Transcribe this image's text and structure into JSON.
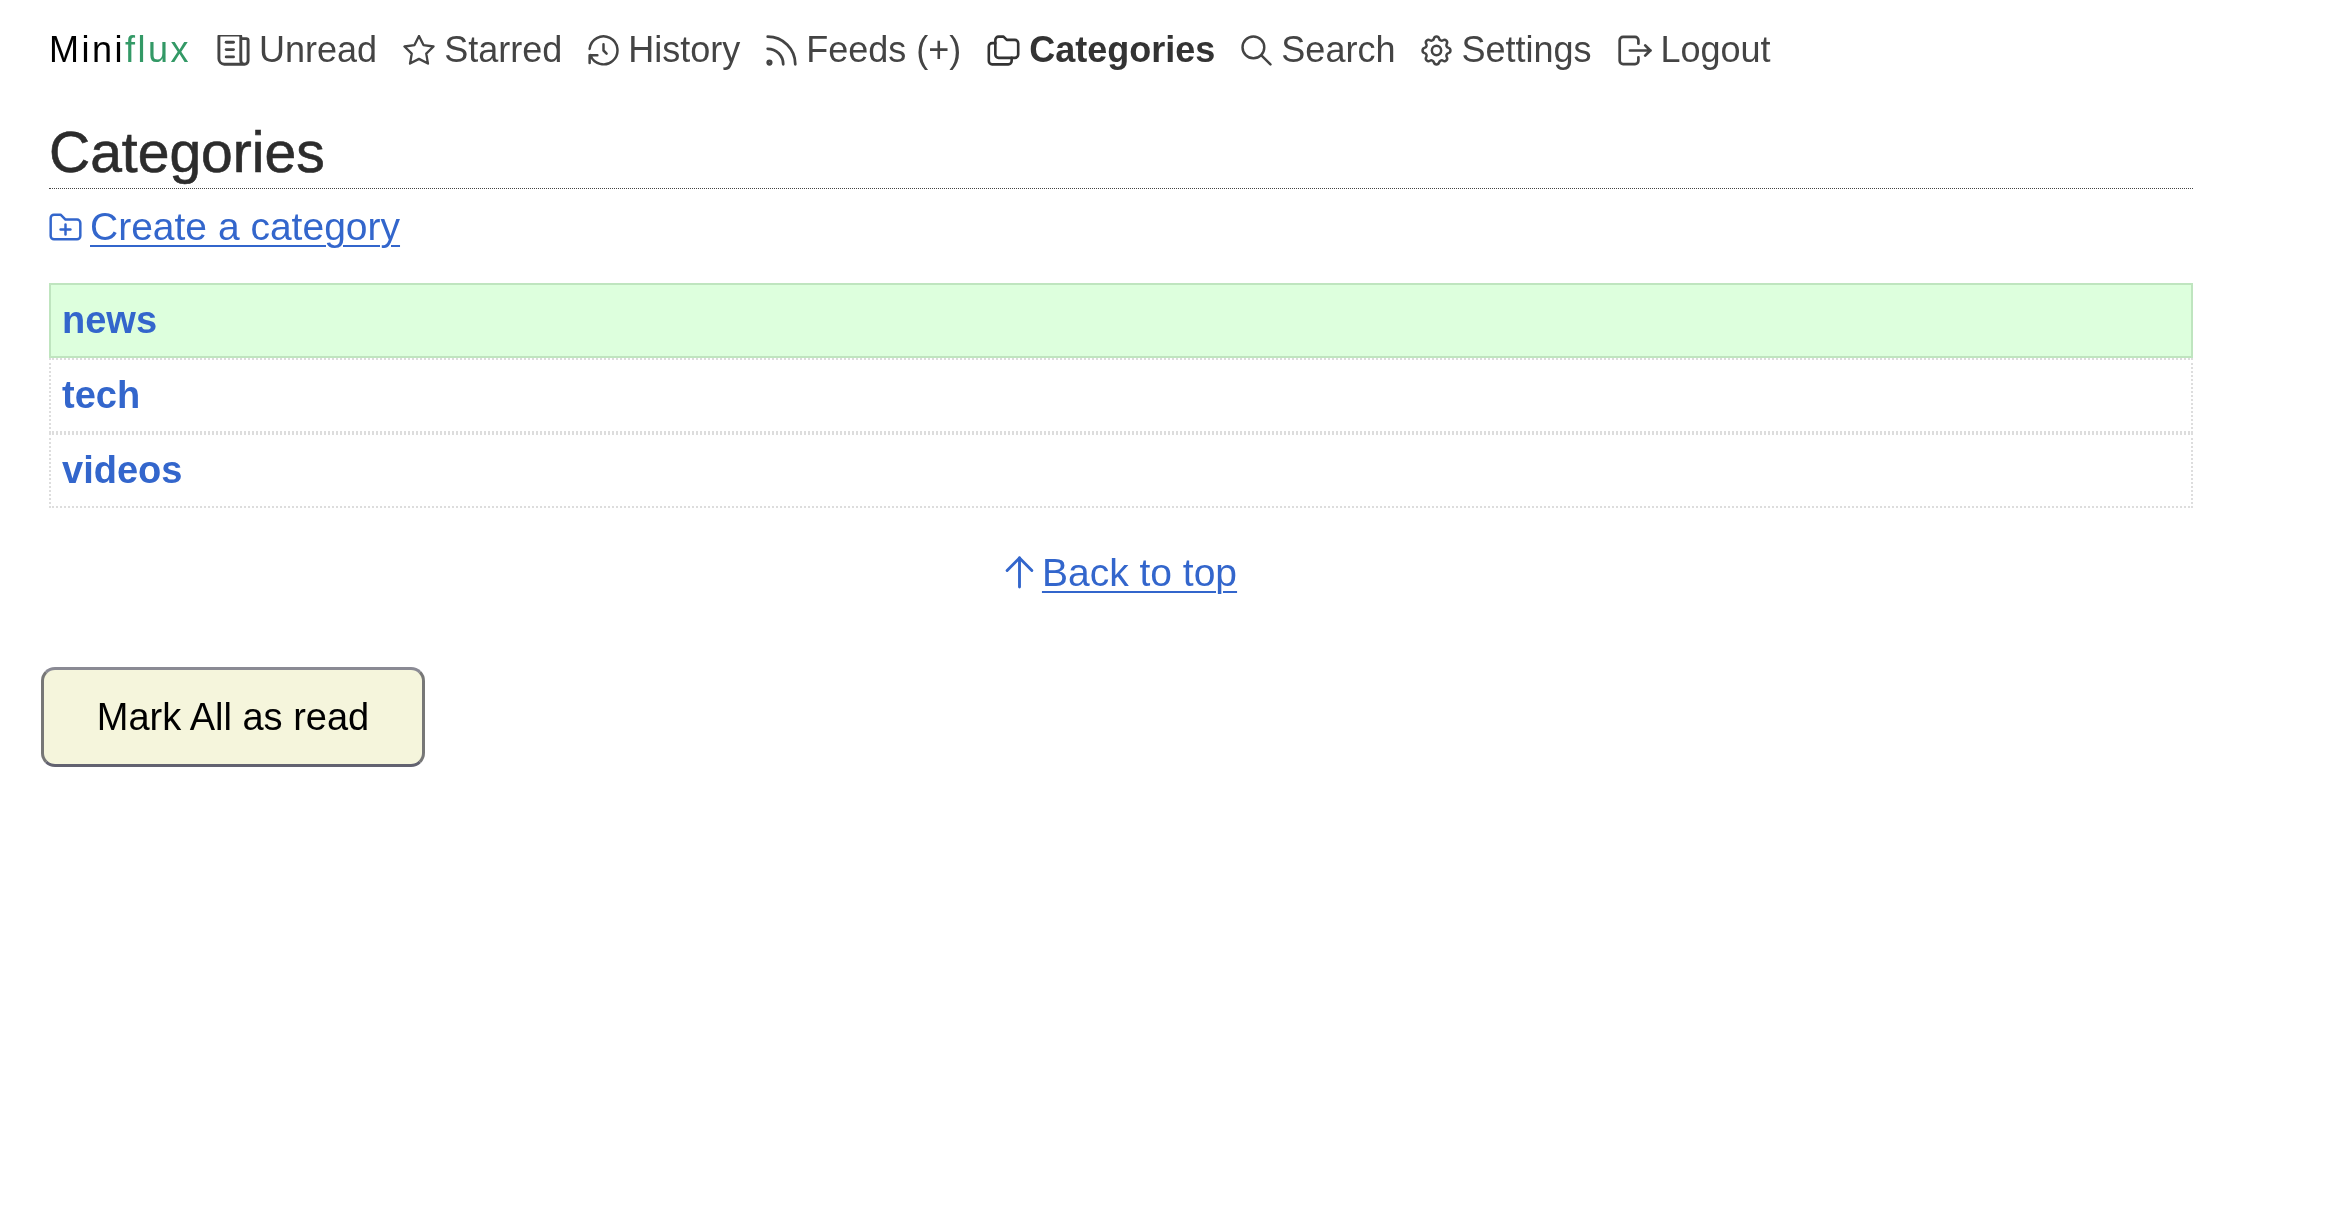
{
  "header": {
    "logo": {
      "main": "Mini",
      "accent": "flux"
    },
    "nav": [
      {
        "label": "Unread",
        "selected": false
      },
      {
        "label": "Starred",
        "selected": false
      },
      {
        "label": "History",
        "selected": false
      },
      {
        "label": "Feeds",
        "add_link": "(+)",
        "selected": false
      },
      {
        "label": "Categories",
        "selected": true
      },
      {
        "label": "Search",
        "selected": false
      },
      {
        "label": "Settings",
        "selected": false
      },
      {
        "label": "Logout",
        "selected": false
      }
    ]
  },
  "page": {
    "title": "Categories",
    "create_link": "Create a category"
  },
  "categories": [
    {
      "name": "news",
      "selected": true
    },
    {
      "name": "tech",
      "selected": false
    },
    {
      "name": "videos",
      "selected": false
    }
  ],
  "back_to_top": "Back to top",
  "mark_all_read_button": "Mark All as read"
}
